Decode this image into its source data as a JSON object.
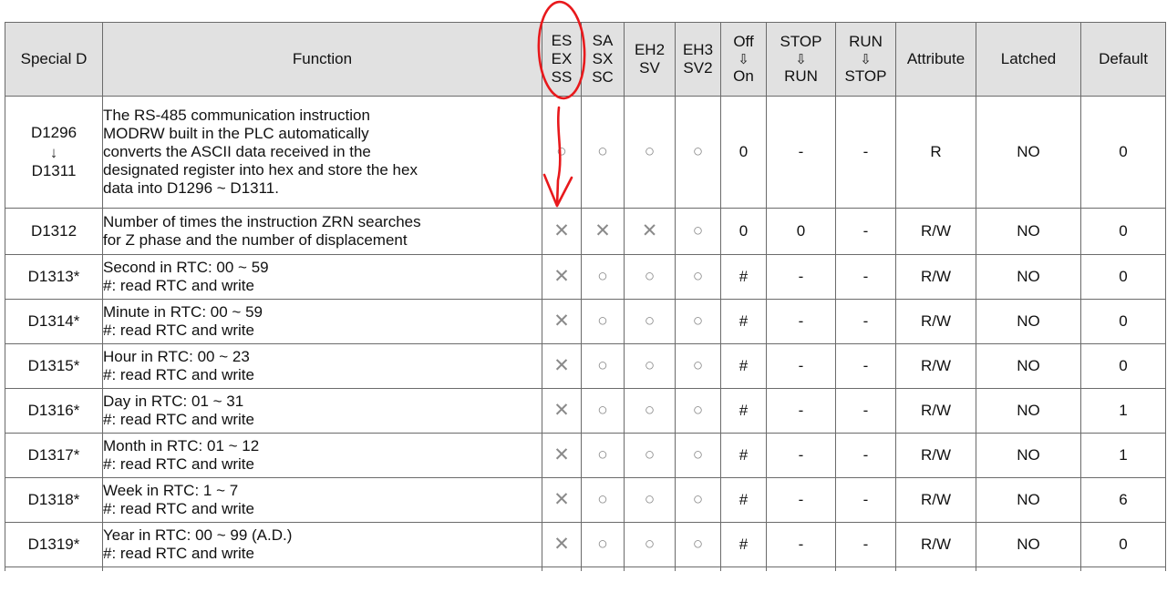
{
  "table": {
    "headers": {
      "special_d": "Special D",
      "function": "Function",
      "es_ex_ss": [
        "ES",
        "EX",
        "SS"
      ],
      "sa_sx_sc": [
        "SA",
        "SX",
        "SC"
      ],
      "eh2_sv": [
        "EH2",
        "SV"
      ],
      "eh3_sv2": [
        "EH3",
        "SV2"
      ],
      "off_on": [
        "Off",
        "⇩",
        "On"
      ],
      "stop_run": [
        "STOP",
        "⇩",
        "RUN"
      ],
      "run_stop": [
        "RUN",
        "⇩",
        "STOP"
      ],
      "attribute": "Attribute",
      "latched": "Latched",
      "default": "Default"
    },
    "rows": [
      {
        "special_d_top": "D1296",
        "special_d_arrow": "↓",
        "special_d_bottom": "D1311",
        "function_lines": [
          "The RS-485 communication instruction",
          "MODRW built in the PLC automatically",
          "converts the ASCII data received in the",
          "designated register into hex and store the hex",
          "data into D1296 ~ D1311."
        ],
        "es_ex_ss": "○",
        "sa_sx_sc": "○",
        "eh2_sv": "○",
        "eh3_sv2": "○",
        "off_on": "0",
        "stop_run": "-",
        "run_stop": "-",
        "attribute": "R",
        "latched": "NO",
        "default": "0"
      },
      {
        "special_d": "D1312",
        "function_lines": [
          "Number of times the instruction ZRN searches",
          "for Z phase and the number of displacement"
        ],
        "es_ex_ss": "✕",
        "sa_sx_sc": "✕",
        "eh2_sv": "✕",
        "eh3_sv2": "○",
        "off_on": "0",
        "stop_run": "0",
        "run_stop": "-",
        "attribute": "R/W",
        "latched": "NO",
        "default": "0"
      },
      {
        "special_d": "D1313*",
        "function_lines": [
          "Second in RTC: 00 ~ 59",
          "#: read RTC and write"
        ],
        "es_ex_ss": "✕",
        "sa_sx_sc": "○",
        "eh2_sv": "○",
        "eh3_sv2": "○",
        "off_on": "#",
        "stop_run": "-",
        "run_stop": "-",
        "attribute": "R/W",
        "latched": "NO",
        "default": "0"
      },
      {
        "special_d": "D1314*",
        "function_lines": [
          "Minute in RTC: 00 ~ 59",
          "#: read RTC and write"
        ],
        "es_ex_ss": "✕",
        "sa_sx_sc": "○",
        "eh2_sv": "○",
        "eh3_sv2": "○",
        "off_on": "#",
        "stop_run": "-",
        "run_stop": "-",
        "attribute": "R/W",
        "latched": "NO",
        "default": "0"
      },
      {
        "special_d": "D1315*",
        "function_lines": [
          "Hour in RTC: 00 ~ 23",
          "#: read RTC and write"
        ],
        "es_ex_ss": "✕",
        "sa_sx_sc": "○",
        "eh2_sv": "○",
        "eh3_sv2": "○",
        "off_on": "#",
        "stop_run": "-",
        "run_stop": "-",
        "attribute": "R/W",
        "latched": "NO",
        "default": "0"
      },
      {
        "special_d": "D1316*",
        "function_lines": [
          "Day in RTC: 01 ~ 31",
          "#: read RTC and write"
        ],
        "es_ex_ss": "✕",
        "sa_sx_sc": "○",
        "eh2_sv": "○",
        "eh3_sv2": "○",
        "off_on": "#",
        "stop_run": "-",
        "run_stop": "-",
        "attribute": "R/W",
        "latched": "NO",
        "default": "1"
      },
      {
        "special_d": "D1317*",
        "function_lines": [
          "Month in RTC: 01 ~ 12",
          "#: read RTC and write"
        ],
        "es_ex_ss": "✕",
        "sa_sx_sc": "○",
        "eh2_sv": "○",
        "eh3_sv2": "○",
        "off_on": "#",
        "stop_run": "-",
        "run_stop": "-",
        "attribute": "R/W",
        "latched": "NO",
        "default": "1"
      },
      {
        "special_d": "D1318*",
        "function_lines": [
          "Week in RTC: 1 ~ 7",
          "#: read RTC and write"
        ],
        "es_ex_ss": "✕",
        "sa_sx_sc": "○",
        "eh2_sv": "○",
        "eh3_sv2": "○",
        "off_on": "#",
        "stop_run": "-",
        "run_stop": "-",
        "attribute": "R/W",
        "latched": "NO",
        "default": "6"
      },
      {
        "special_d": "D1319*",
        "function_lines": [
          "Year in RTC: 00 ~ 99 (A.D.)",
          "#: read RTC and write"
        ],
        "es_ex_ss": "✕",
        "sa_sx_sc": "○",
        "eh2_sv": "○",
        "eh3_sv2": "○",
        "off_on": "#",
        "stop_run": "-",
        "run_stop": "-",
        "attribute": "R/W",
        "latched": "NO",
        "default": "0"
      }
    ]
  },
  "annotation": {
    "color": "#e8191c",
    "shapes": [
      "ellipse-around-es-ex-ss-header",
      "down-arrow-to-d1312-row"
    ]
  }
}
